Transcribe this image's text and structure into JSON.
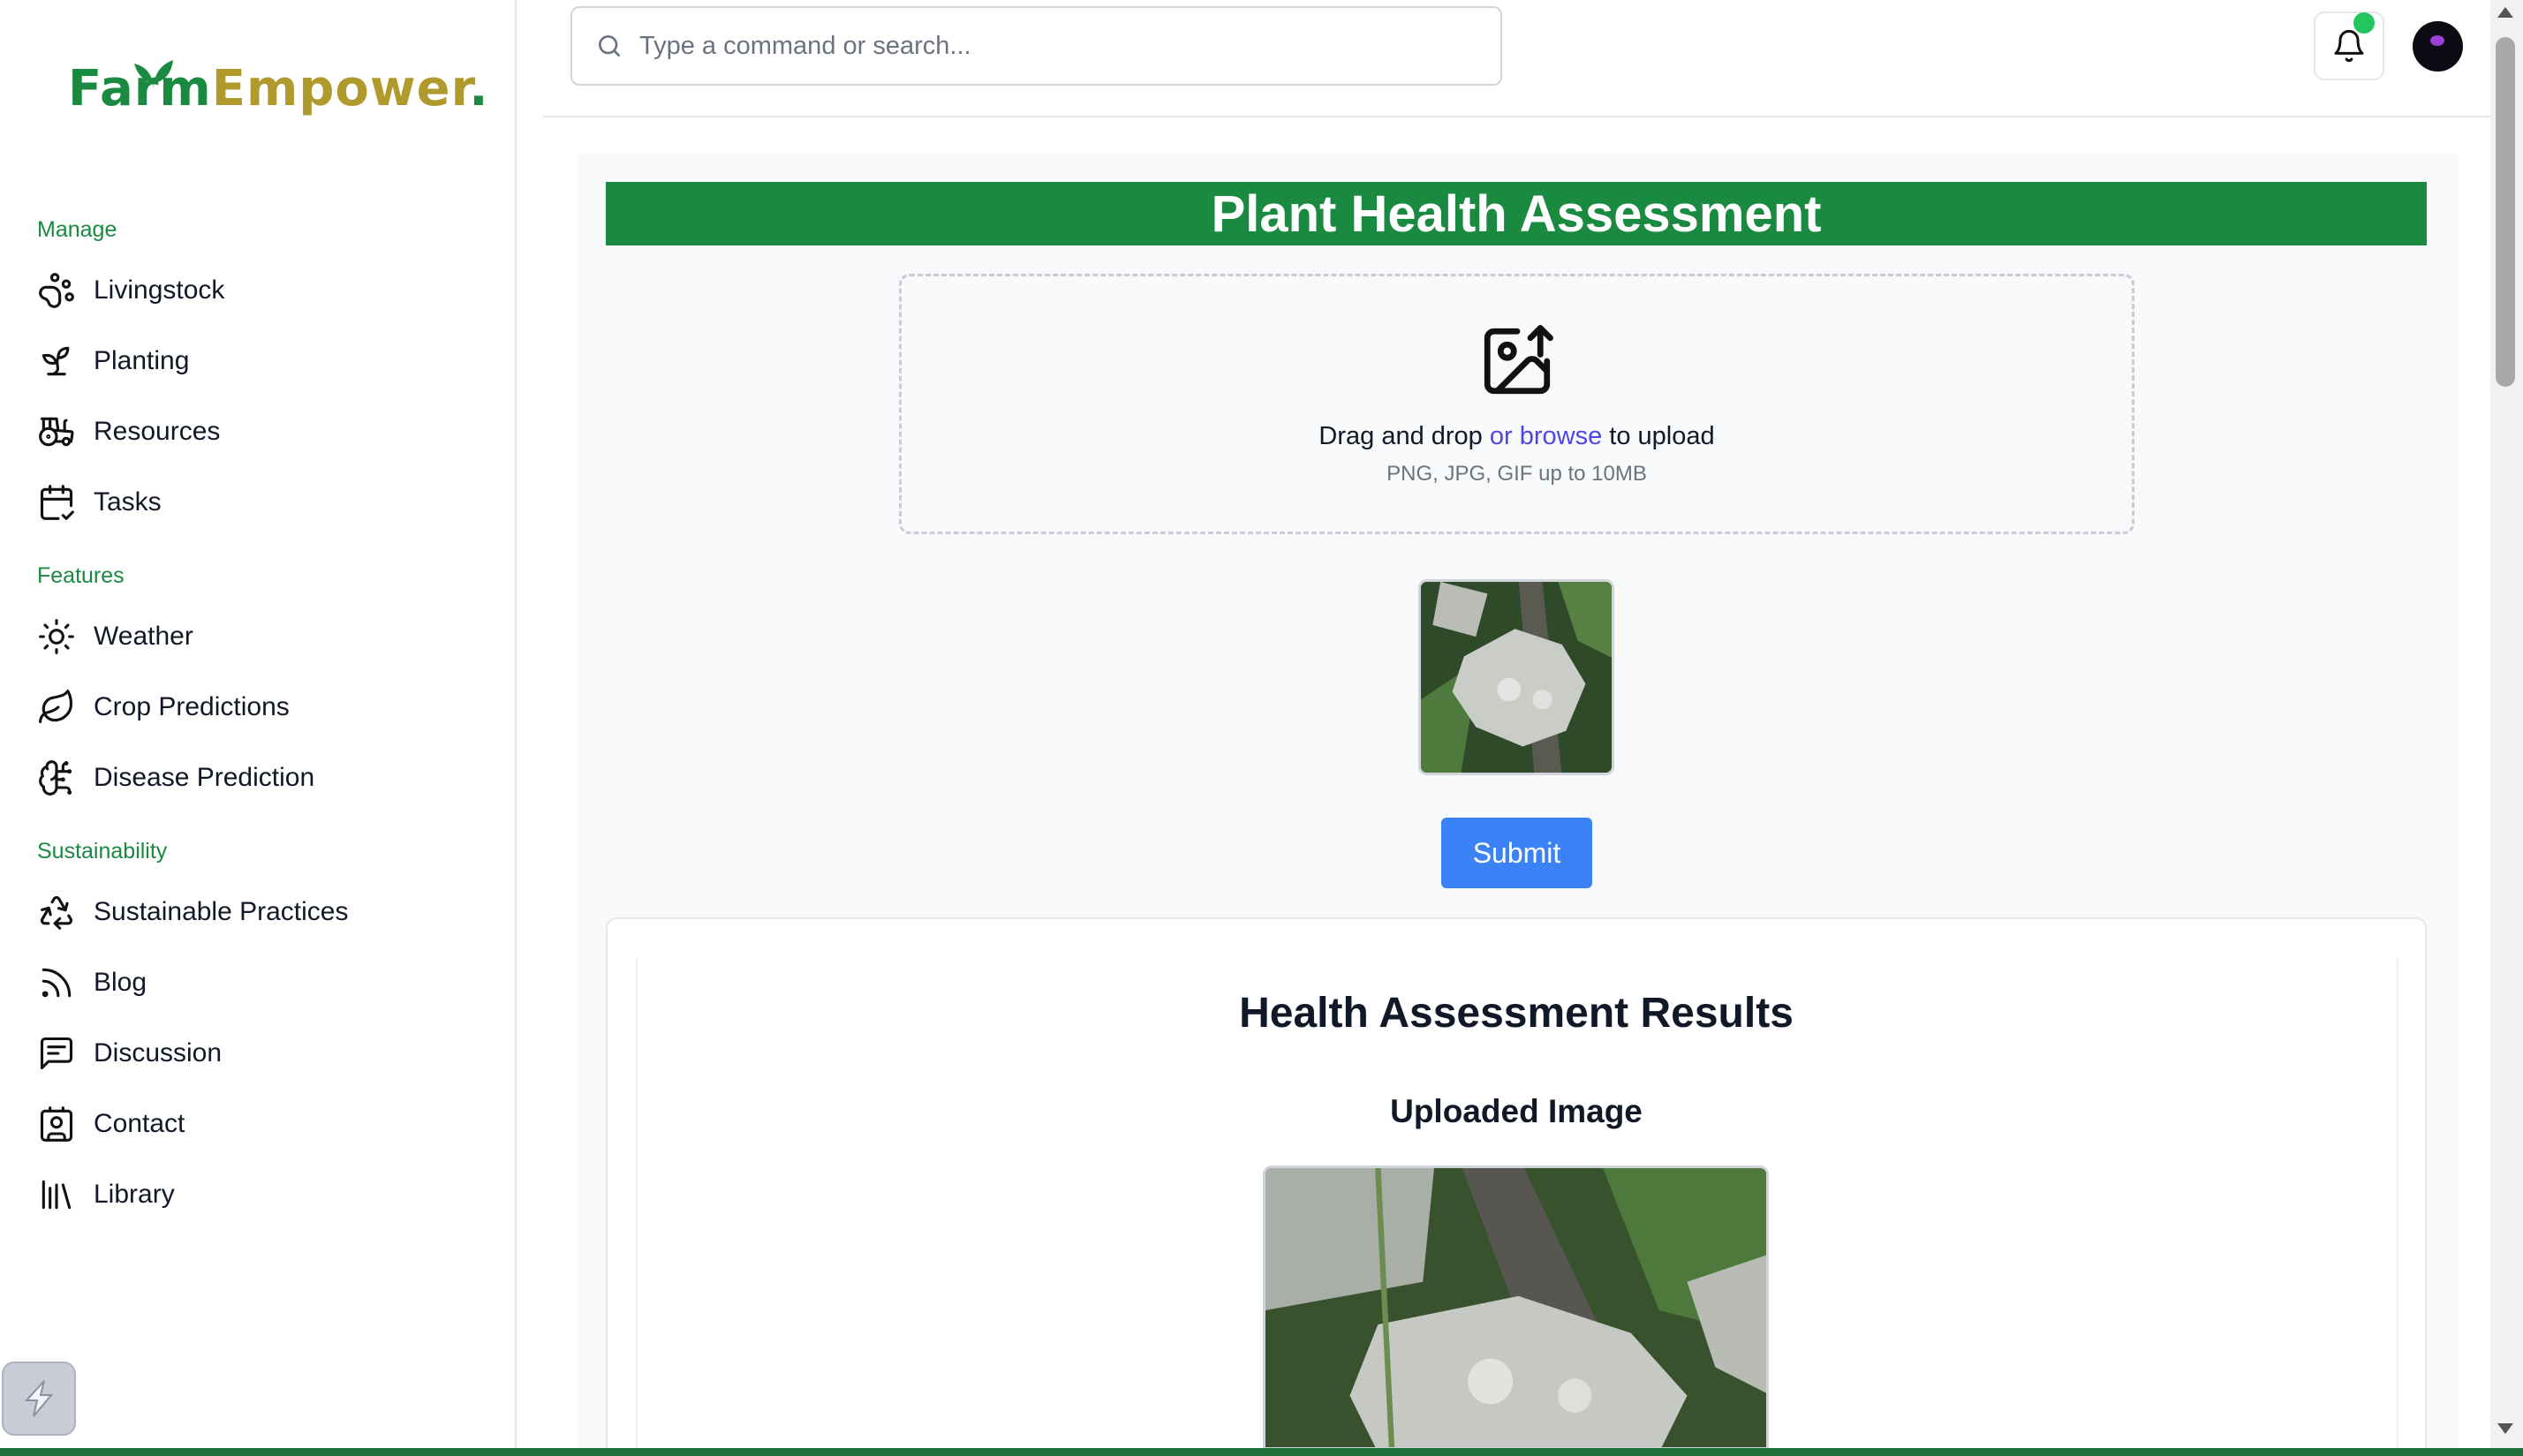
{
  "brand": {
    "part1": "Farm",
    "part2": "Empower",
    "dot": "."
  },
  "search": {
    "placeholder": "Type a command or search..."
  },
  "sidebar": {
    "sections": [
      {
        "label": "Manage",
        "items": [
          {
            "label": "Livingstock",
            "icon": "paw-icon"
          },
          {
            "label": "Planting",
            "icon": "sprout-icon"
          },
          {
            "label": "Resources",
            "icon": "tractor-icon"
          },
          {
            "label": "Tasks",
            "icon": "calendar-check-icon"
          }
        ]
      },
      {
        "label": "Features",
        "items": [
          {
            "label": "Weather",
            "icon": "sun-icon"
          },
          {
            "label": "Crop Predictions",
            "icon": "leaf-icon"
          },
          {
            "label": "Disease Prediction",
            "icon": "brain-icon"
          }
        ]
      },
      {
        "label": "Sustainability",
        "items": [
          {
            "label": "Sustainable Practices",
            "icon": "recycle-icon"
          },
          {
            "label": "Blog",
            "icon": "rss-icon"
          },
          {
            "label": "Discussion",
            "icon": "message-square-icon"
          },
          {
            "label": "Contact",
            "icon": "contact-icon"
          },
          {
            "label": "Library",
            "icon": "library-icon"
          }
        ]
      }
    ]
  },
  "main": {
    "title": "Plant Health Assessment",
    "upload": {
      "text_before": "Drag and drop ",
      "browse": "or browse",
      "text_after": " to upload",
      "hint": "PNG, JPG, GIF up to 10MB"
    },
    "submit_label": "Submit",
    "results": {
      "title": "Health Assessment Results",
      "uploaded_label": "Uploaded Image"
    }
  },
  "colors": {
    "brand_green": "#1a8a41",
    "brand_gold": "#b19a2d",
    "submit_blue": "#3b82f6",
    "browse_link": "#4f46e5",
    "notification_dot": "#22c55e"
  }
}
